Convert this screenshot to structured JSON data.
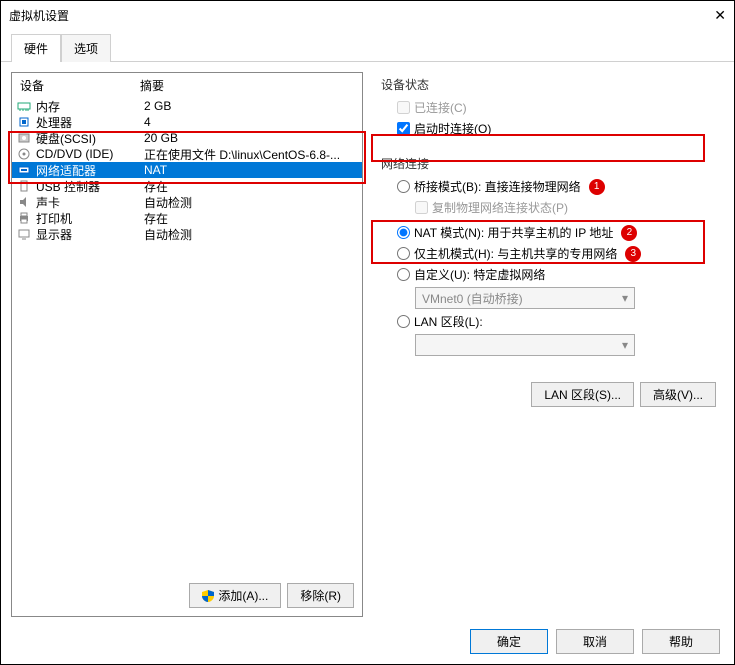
{
  "window": {
    "title": "虚拟机设置"
  },
  "tabs": {
    "hardware": "硬件",
    "options": "选项"
  },
  "list": {
    "header_device": "设备",
    "header_summary": "摘要",
    "items": [
      {
        "name": "内存",
        "summary": "2 GB",
        "icon": "memory"
      },
      {
        "name": "处理器",
        "summary": "4",
        "icon": "cpu"
      },
      {
        "name": "硬盘(SCSI)",
        "summary": "20 GB",
        "icon": "disk"
      },
      {
        "name": "CD/DVD (IDE)",
        "summary": "正在使用文件 D:\\linux\\CentOS-6.8-...",
        "icon": "cd"
      },
      {
        "name": "网络适配器",
        "summary": "NAT",
        "icon": "nic"
      },
      {
        "name": "USB 控制器",
        "summary": "存在",
        "icon": "usb"
      },
      {
        "name": "声卡",
        "summary": "自动检测",
        "icon": "sound"
      },
      {
        "name": "打印机",
        "summary": "存在",
        "icon": "printer"
      },
      {
        "name": "显示器",
        "summary": "自动检测",
        "icon": "display"
      }
    ]
  },
  "left_buttons": {
    "add": "添加(A)...",
    "remove": "移除(R)"
  },
  "status": {
    "group": "设备状态",
    "connected": "已连接(C)",
    "connect_on": "启动时连接(O)"
  },
  "net": {
    "group": "网络连接",
    "bridged": "桥接模式(B): 直接连接物理网络",
    "replicate": "复制物理网络连接状态(P)",
    "nat": "NAT 模式(N): 用于共享主机的 IP 地址",
    "hostonly": "仅主机模式(H): 与主机共享的专用网络",
    "custom": "自定义(U): 特定虚拟网络",
    "custom_value": "VMnet0 (自动桥接)",
    "lan": "LAN 区段(L):",
    "lan_btn": "LAN 区段(S)...",
    "adv_btn": "高级(V)..."
  },
  "badges": {
    "b1": "1",
    "b2": "2",
    "b3": "3"
  },
  "bottom": {
    "ok": "确定",
    "cancel": "取消",
    "help": "帮助"
  }
}
